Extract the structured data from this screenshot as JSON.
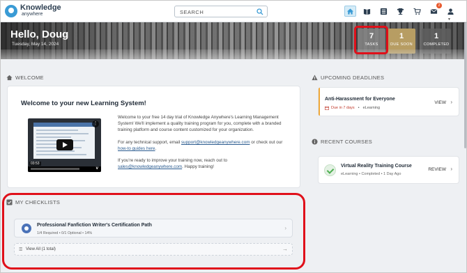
{
  "header": {
    "logo_main": "Knowledge",
    "logo_sub": "anywhere",
    "search_placeholder": "SEARCH",
    "nav_icons": [
      "home-icon",
      "catalog-icon",
      "list-icon",
      "trophy-icon",
      "cart-icon",
      "mail-icon",
      "user-icon"
    ],
    "mail_badge": "2"
  },
  "banner": {
    "greeting": "Hello, Doug",
    "date": "Tuesday, May 14, 2024",
    "stats": [
      {
        "value": "7",
        "label": "TASKS"
      },
      {
        "value": "1",
        "label": "DUE SOON"
      },
      {
        "value": "1",
        "label": "COMPLETED"
      }
    ]
  },
  "welcome": {
    "section_title": "WELCOME",
    "card_title": "Welcome to your new Learning System!",
    "video_time": "03:53",
    "video_brand": "v",
    "para1": "Welcome to your free 14 day trial of Knowledge Anywhere's Learning Management System! We'll implement a quality training program for you, complete with a branded training platform and course content customized for your organization.",
    "para2_prefix": "For any technical support, email ",
    "para2_email": "support@knowledgeanywhere.com",
    "para2_mid": " or check out our ",
    "para2_link": "how-to guides here",
    "para2_suffix": ".",
    "para3_prefix": "If you're ready to improve your training now, reach out to ",
    "para3_email": "sales@knowledgeanywhere.com",
    "para3_suffix": ". Happy training!"
  },
  "deadlines": {
    "section_title": "UPCOMING DEADLINES",
    "item_title": "Anti-Harassment for Everyone",
    "due": "Due in 7 days",
    "type": "eLearning",
    "action": "VIEW"
  },
  "recent": {
    "section_title": "RECENT COURSES",
    "item_title": "Virtual Reality Training Course",
    "meta": "eLearning  •  Completed  •  1 Day Ago",
    "action": "REVIEW"
  },
  "checklists": {
    "section_title": "MY CHECKLISTS",
    "item_title": "Professional Fanfiction Writer's Certification Path",
    "item_meta": "1/4 Required  •  0/1 Optional  •  14%",
    "view_all": "View All (1 total)"
  },
  "colors": {
    "accent_blue": "#3a9bd5",
    "highlight_red": "#e0101a",
    "due_soon_gold": "#b79d63",
    "deadline_orange": "#f0a83a"
  }
}
